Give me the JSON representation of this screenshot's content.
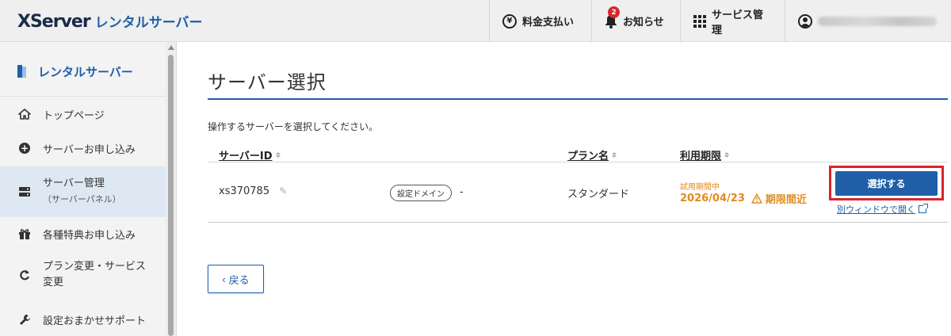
{
  "header": {
    "logo_brand": "XServer",
    "logo_product": "レンタルサーバー",
    "nav": {
      "billing": "料金支払い",
      "notifications": "お知らせ",
      "notification_count": "2",
      "service_management": "サービス管理"
    }
  },
  "sidebar": {
    "title": "レンタルサーバー",
    "items": [
      {
        "label": "トップページ",
        "icon": "home-icon"
      },
      {
        "label": "サーバーお申し込み",
        "icon": "plus-circle-icon"
      },
      {
        "label": "サーバー管理",
        "sublabel": "（サーバーパネル）",
        "icon": "server-icon",
        "active": true
      },
      {
        "label": "各種特典お申し込み",
        "icon": "gift-icon"
      },
      {
        "label": "プラン変更・サービス変更",
        "label_line1": "プラン変更・サービス",
        "label_line2": "変更",
        "icon": "refresh-icon"
      },
      {
        "label": "設定おまかせサポート",
        "icon": "wrench-icon"
      }
    ]
  },
  "main": {
    "title": "サーバー選択",
    "description": "操作するサーバーを選択してください。",
    "columns": [
      "サーバーID",
      "プラン名",
      "利用期限"
    ],
    "rows": [
      {
        "server_id": "xs370785",
        "domain_tag": "設定ドメイン",
        "domain_value": "-",
        "plan": "スタンダード",
        "period_note": "試用期間中",
        "expiry_date": "2026/04/23",
        "expiry_warning": "期限間近",
        "action_label": "選択する",
        "open_new_window": "別ウィンドウで開く"
      }
    ],
    "back_label": "戻る"
  },
  "colors": {
    "brand_blue": "#1f5fa8",
    "warning_orange": "#e08b1e",
    "highlight_red": "#d9232d"
  }
}
